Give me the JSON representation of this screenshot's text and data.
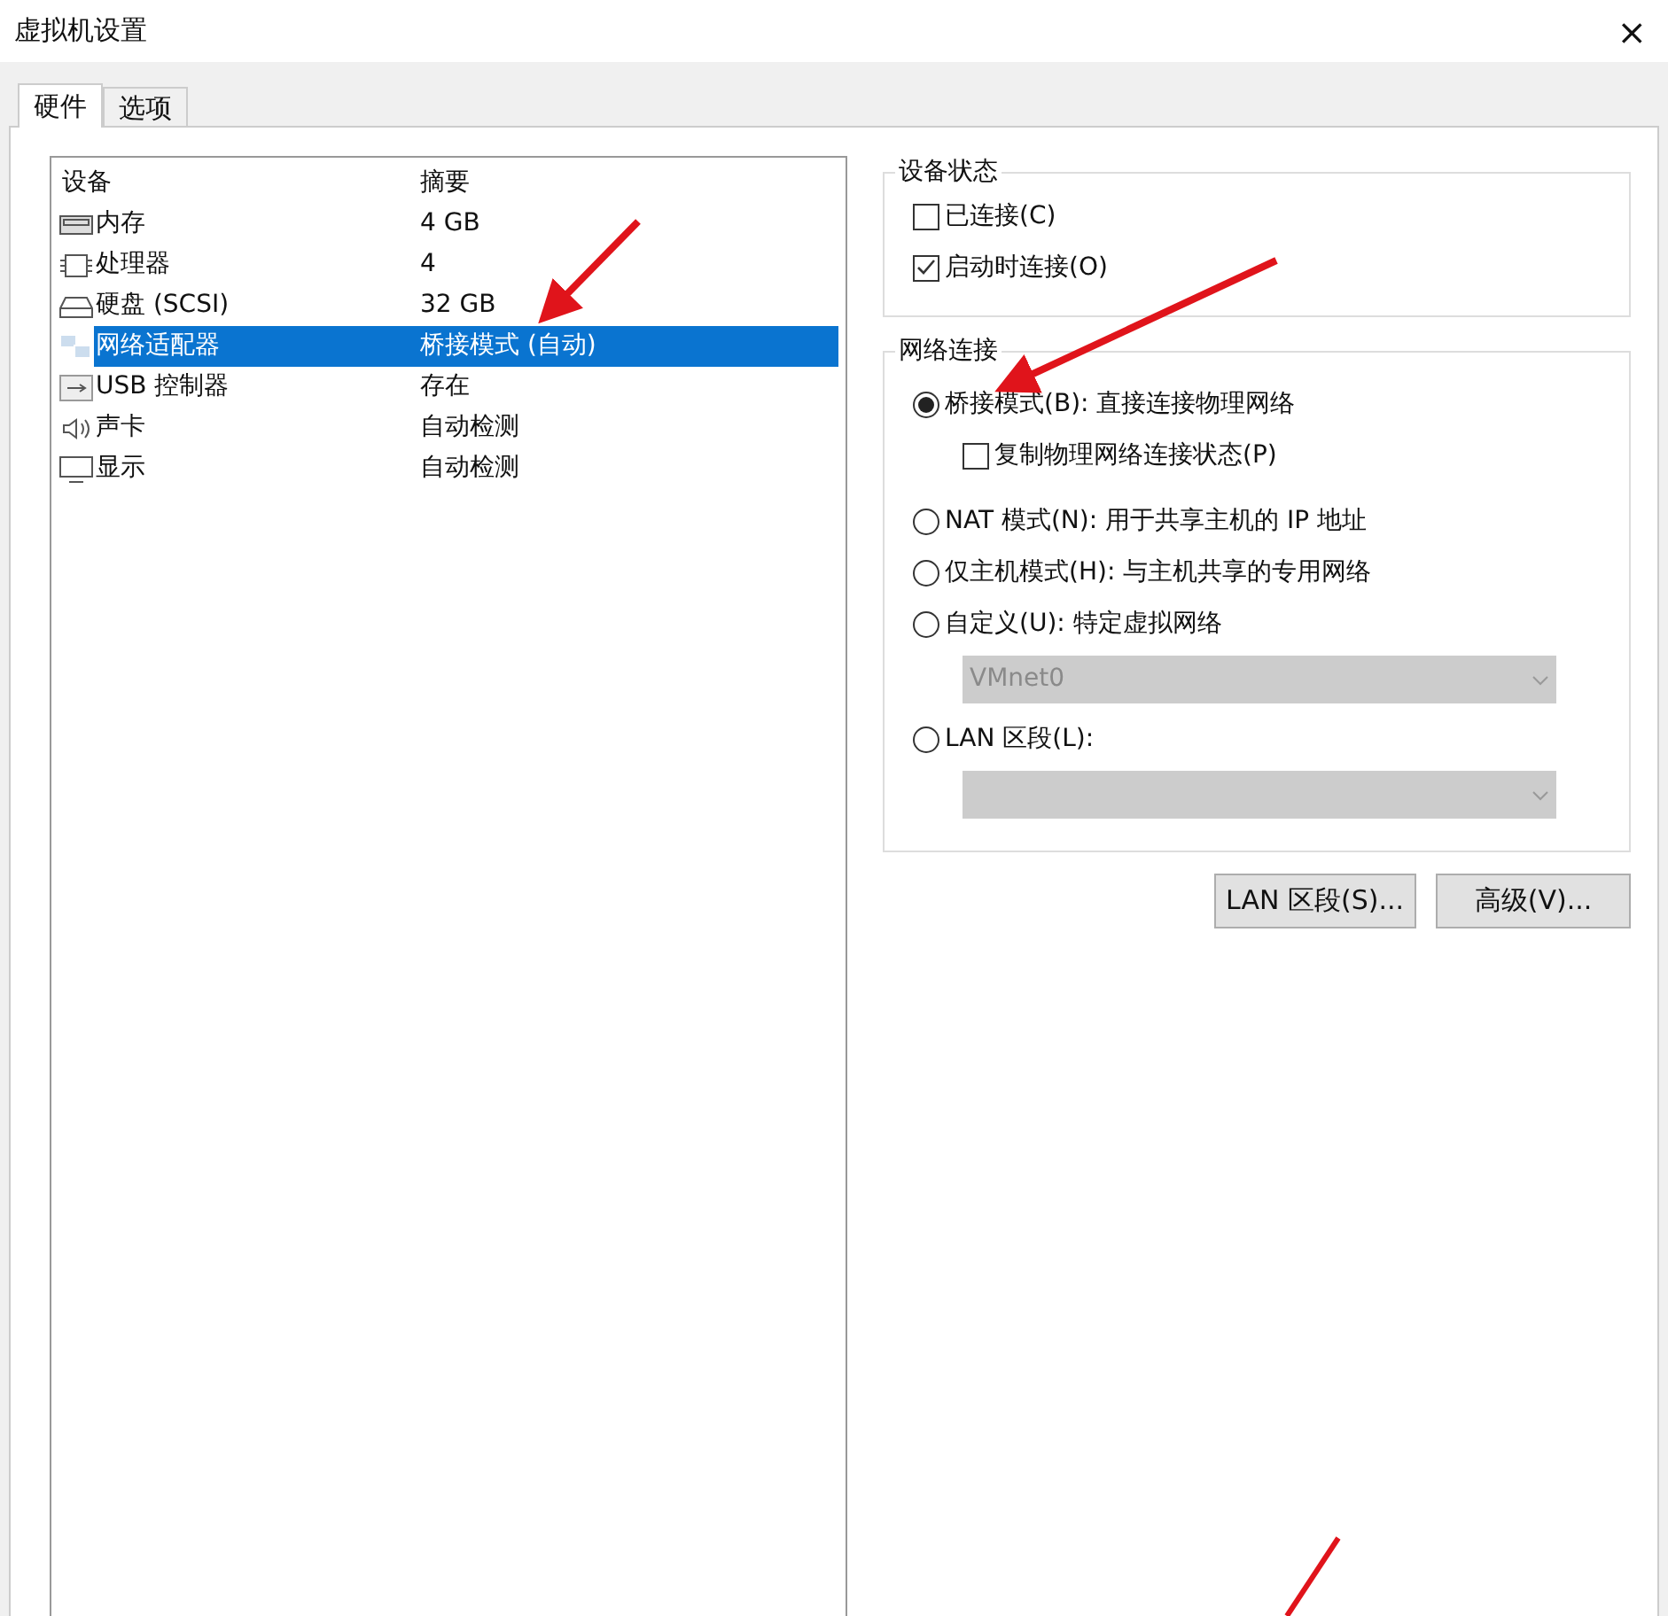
{
  "window": {
    "title": "虚拟机设置",
    "close": "×"
  },
  "tabs": [
    {
      "label": "硬件",
      "selected": true
    },
    {
      "label": "选项",
      "selected": false
    }
  ],
  "devices": {
    "columns": [
      "设备",
      "摘要"
    ],
    "rows": [
      {
        "kind": "memory",
        "name": "内存",
        "summary": "4 GB",
        "selected": false
      },
      {
        "kind": "cpu",
        "name": "处理器",
        "summary": "4",
        "selected": false
      },
      {
        "kind": "disk",
        "name": "硬盘 (SCSI)",
        "summary": "32 GB",
        "selected": false
      },
      {
        "kind": "network",
        "name": "网络适配器",
        "summary": "桥接模式 (自动)",
        "selected": true
      },
      {
        "kind": "usb",
        "name": "USB 控制器",
        "summary": "存在",
        "selected": false
      },
      {
        "kind": "sound",
        "name": "声卡",
        "summary": "自动检测",
        "selected": false
      },
      {
        "kind": "display",
        "name": "显示",
        "summary": "自动检测",
        "selected": false
      }
    ]
  },
  "device_status": {
    "title": "设备状态",
    "options": [
      {
        "label": "已连接(C)",
        "checked": false
      },
      {
        "label": "启动时连接(O)",
        "checked": true
      }
    ]
  },
  "network_connection": {
    "title": "网络连接",
    "items": [
      {
        "kind": "radio",
        "label": "桥接模式(B): 直接连接物理网络",
        "selected": true
      },
      {
        "kind": "checkbox",
        "label": "复制物理网络连接状态(P)",
        "checked": false
      },
      {
        "kind": "radio",
        "label": "NAT 模式(N): 用于共享主机的 IP 地址",
        "selected": false
      },
      {
        "kind": "radio",
        "label": "仅主机模式(H): 与主机共享的专用网络",
        "selected": false
      },
      {
        "kind": "radio",
        "label": "自定义(U): 特定虚拟网络",
        "selected": false
      },
      {
        "kind": "dropdown",
        "value": "VMnet0",
        "disabled": true
      },
      {
        "kind": "radio",
        "label": "LAN 区段(L):",
        "selected": false
      },
      {
        "kind": "dropdown",
        "disabled": true
      }
    ]
  },
  "buttons": [
    "LAN 区段(S)...",
    "高级(V)..."
  ]
}
